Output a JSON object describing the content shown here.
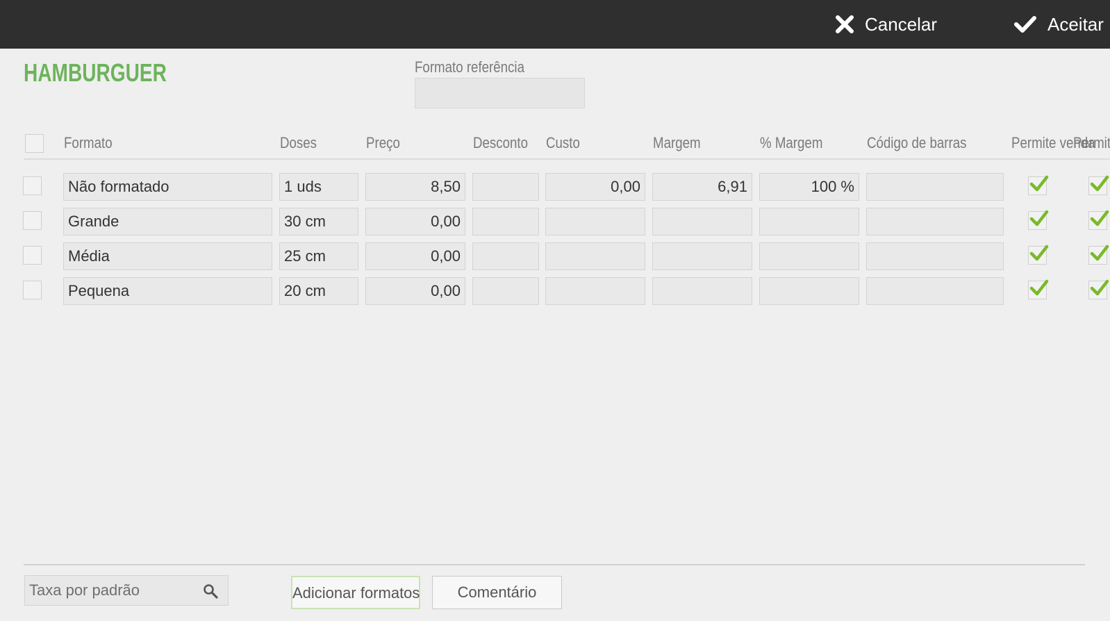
{
  "topbar": {
    "cancel_label": "Cancelar",
    "cancel_icon": "close-icon",
    "accept_label": "Aceitar",
    "accept_icon": "check-icon"
  },
  "title": "HAMBURGUER",
  "reference": {
    "label": "Formato referência",
    "value": ""
  },
  "columns": [
    "Formato",
    "Doses",
    "Preço",
    "Desconto",
    "Custo",
    "Margem",
    "% Margem",
    "Código de barras",
    "Permite venda",
    "Permit"
  ],
  "rows": [
    {
      "formato": "Não formatado",
      "doses": "1 uds",
      "preco": "8,50",
      "desconto": "",
      "custo": "0,00",
      "margem": "6,91",
      "pct_margem": "100 %",
      "codigo": "",
      "permite_venda": true,
      "permite_2": true
    },
    {
      "formato": "Grande",
      "doses": "30 cm",
      "preco": "0,00",
      "desconto": "",
      "custo": "",
      "margem": "",
      "pct_margem": "",
      "codigo": "",
      "permite_venda": true,
      "permite_2": true
    },
    {
      "formato": "Média",
      "doses": "25 cm",
      "preco": "0,00",
      "desconto": "",
      "custo": "",
      "margem": "",
      "pct_margem": "",
      "codigo": "",
      "permite_venda": true,
      "permite_2": true
    },
    {
      "formato": "Pequena",
      "doses": "20 cm",
      "preco": "0,00",
      "desconto": "",
      "custo": "",
      "margem": "",
      "pct_margem": "",
      "codigo": "",
      "permite_venda": true,
      "permite_2": true
    }
  ],
  "footer": {
    "tax_placeholder": "Taxa por padrão",
    "tax_icon": "search-icon",
    "add_formats_label": "Adicionar formatos",
    "comment_label": "Comentário"
  },
  "colors": {
    "topbar": "#2f2f2f",
    "accent_green": "#6db35b",
    "check_green": "#7ab929",
    "background": "#efefef"
  }
}
